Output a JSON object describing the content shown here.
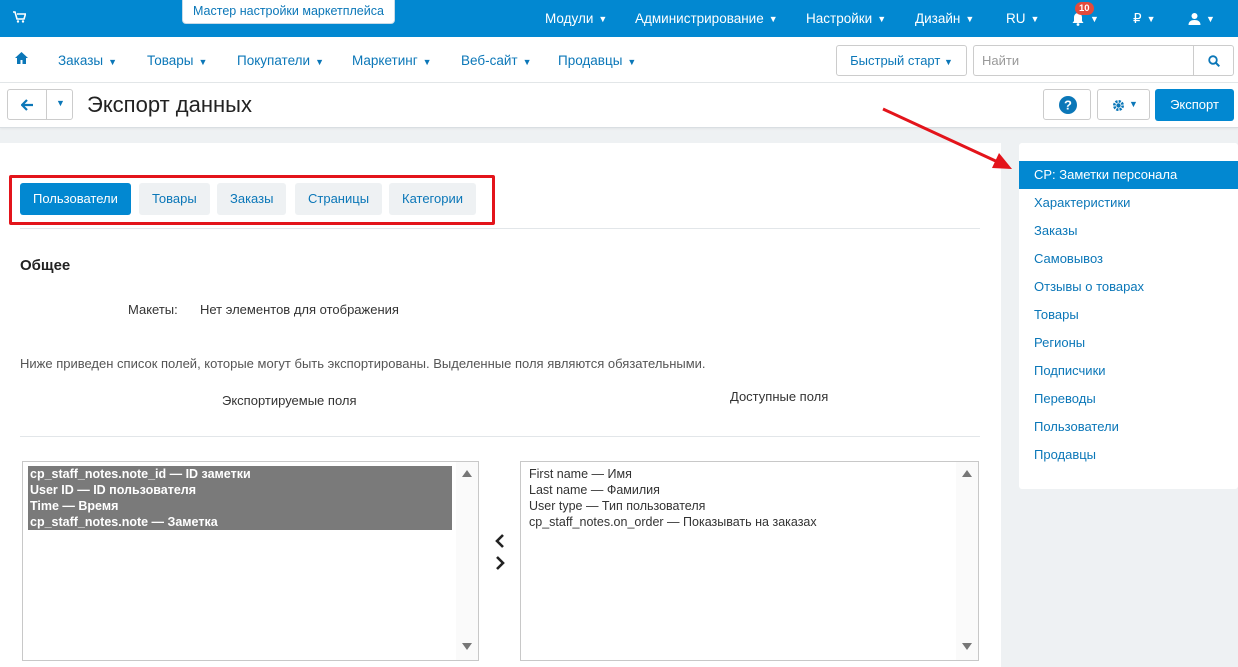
{
  "colors": {
    "brand": "#0288d1",
    "highlight": "#e3141b",
    "link": "#0b77b8"
  },
  "topbar": {
    "wizard_label": "Мастер настройки маркетплейса",
    "menus": [
      "Модули",
      "Администрирование",
      "Настройки",
      "Дизайн",
      "RU"
    ],
    "notifications_count": "10",
    "currency": "₽"
  },
  "nav": {
    "items": [
      "Заказы",
      "Товары",
      "Покупатели",
      "Маркетинг",
      "Веб-сайт",
      "Продавцы"
    ],
    "quick_start": "Быстрый старт",
    "search_placeholder": "Найти"
  },
  "header": {
    "title": "Экспорт данных",
    "export_label": "Экспорт"
  },
  "tabs": [
    "Пользователи",
    "Товары",
    "Заказы",
    "Страницы",
    "Категории"
  ],
  "general": {
    "title": "Общее",
    "layouts_label": "Макеты:",
    "layouts_value": "Нет элементов для отображения",
    "hint": "Ниже приведен список полей, которые могут быть экспортированы. Выделенные поля являются обязательными.",
    "exported_header": "Экспортируемые поля",
    "available_header": "Доступные поля"
  },
  "exported_fields": [
    "cp_staff_notes.note_id — ID заметки",
    "User ID — ID пользователя",
    "Time — Время",
    "cp_staff_notes.note — Заметка"
  ],
  "available_fields": [
    "First name — Имя",
    "Last name — Фамилия",
    "User type — Тип пользователя",
    "cp_staff_notes.on_order — Показывать на заказах"
  ],
  "sidebar": {
    "items": [
      "CP: Заметки персонала",
      "Характеристики",
      "Заказы",
      "Самовывоз",
      "Отзывы о товарах",
      "Товары",
      "Регионы",
      "Подписчики",
      "Переводы",
      "Пользователи",
      "Продавцы"
    ]
  }
}
